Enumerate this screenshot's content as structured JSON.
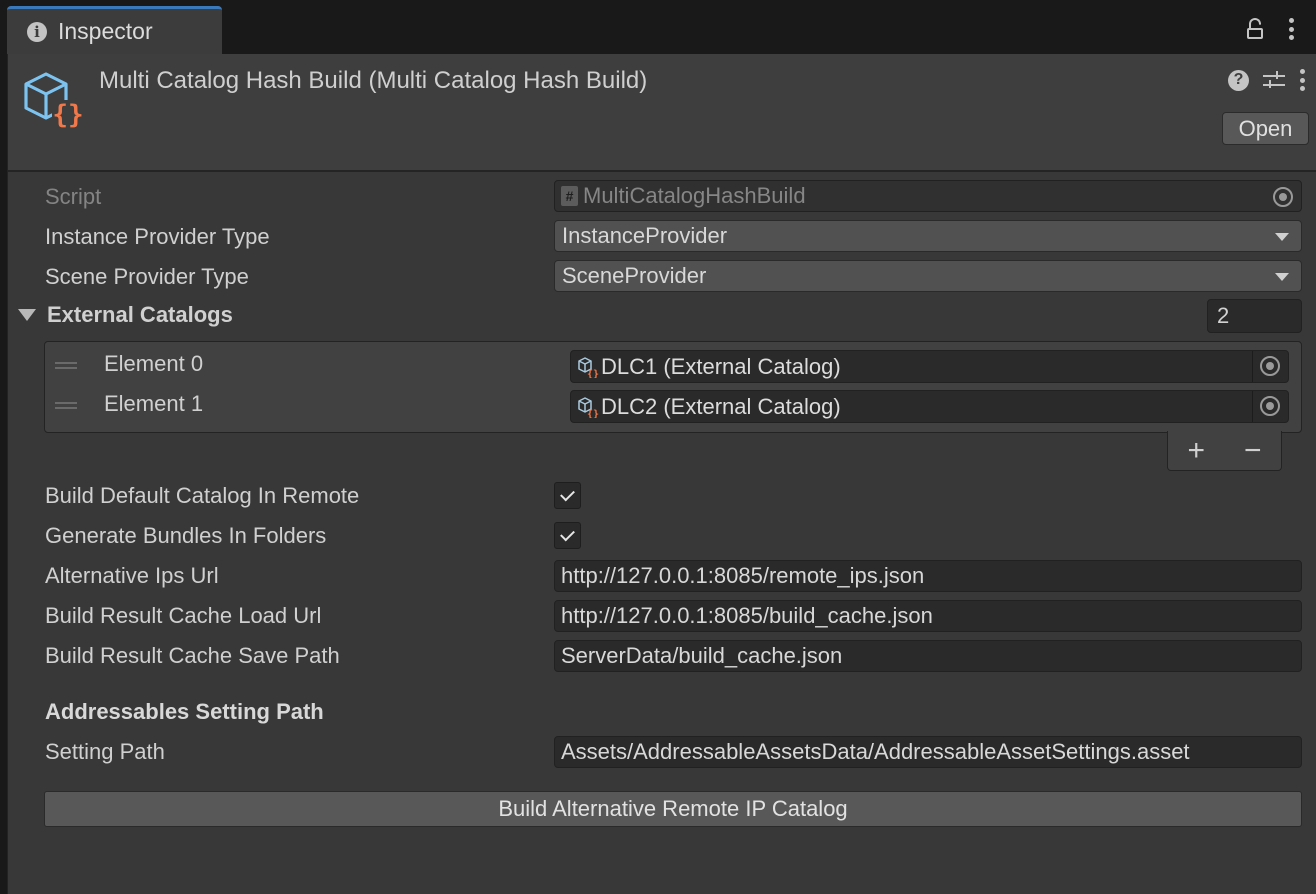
{
  "tab": {
    "title": "Inspector",
    "icon": "info-icon"
  },
  "header": {
    "title": "Multi Catalog Hash Build (Multi Catalog Hash Build)",
    "open_label": "Open"
  },
  "fields": {
    "script": {
      "label": "Script",
      "value": "MultiCatalogHashBuild"
    },
    "instance_provider": {
      "label": "Instance Provider Type",
      "value": "InstanceProvider"
    },
    "scene_provider": {
      "label": "Scene Provider Type",
      "value": "SceneProvider"
    }
  },
  "external_catalogs": {
    "label": "External Catalogs",
    "count": "2",
    "items": [
      {
        "label": "Element 0",
        "value": "DLC1 (External Catalog)"
      },
      {
        "label": "Element 1",
        "value": "DLC2 (External Catalog)"
      }
    ],
    "add_label": "+",
    "remove_label": "−"
  },
  "options": {
    "build_default": {
      "label": "Build Default Catalog In Remote",
      "checked": true
    },
    "generate_bundles": {
      "label": "Generate Bundles In Folders",
      "checked": true
    },
    "alt_ips_url": {
      "label": "Alternative Ips Url",
      "value": "http://127.0.0.1:8085/remote_ips.json"
    },
    "cache_load_url": {
      "label": "Build Result Cache Load Url",
      "value": "http://127.0.0.1:8085/build_cache.json"
    },
    "cache_save_path": {
      "label": "Build Result Cache Save Path",
      "value": "ServerData/build_cache.json"
    }
  },
  "addressables": {
    "section_title": "Addressables Setting Path",
    "setting_path": {
      "label": "Setting Path",
      "value": "Assets/AddressableAssetsData/AddressableAssetSettings.asset"
    }
  },
  "build_button_label": "Build Alternative Remote IP Catalog",
  "colors": {
    "accent": "#3a79bb",
    "asset_cube": "#7cc3f0",
    "asset_braces": "#f0784a"
  }
}
